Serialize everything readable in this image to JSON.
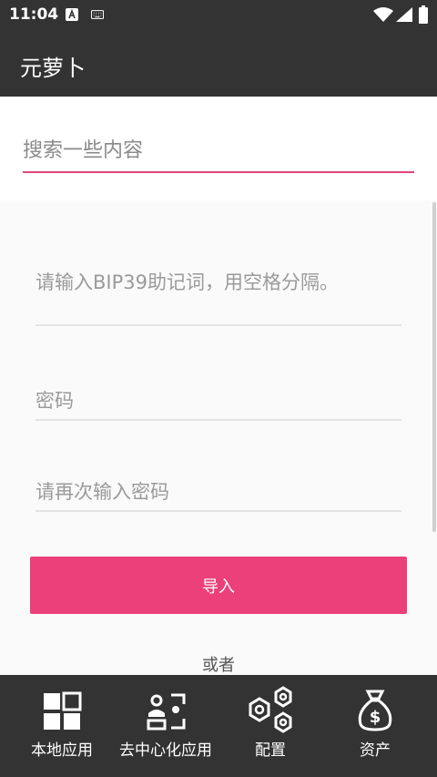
{
  "status_bar": {
    "time": "11:04"
  },
  "app_bar": {
    "title": "元萝卜"
  },
  "search": {
    "placeholder": "搜索一些内容"
  },
  "form": {
    "mnemonic_placeholder": "请输入BIP39助记词，用空格分隔。",
    "password_placeholder": "密码",
    "confirm_password_placeholder": "请再次输入密码",
    "import_label": "导入",
    "or_label": "或者"
  },
  "bottom_nav": {
    "items": [
      {
        "label": "本地应用",
        "icon": "grid-icon"
      },
      {
        "label": "去中心化应用",
        "icon": "people-icon"
      },
      {
        "label": "配置",
        "icon": "hexagons-icon"
      },
      {
        "label": "资产",
        "icon": "money-bag-icon"
      }
    ]
  },
  "colors": {
    "bar": "#333333",
    "accent": "#eb407a",
    "search_underline": "#e0457b"
  }
}
